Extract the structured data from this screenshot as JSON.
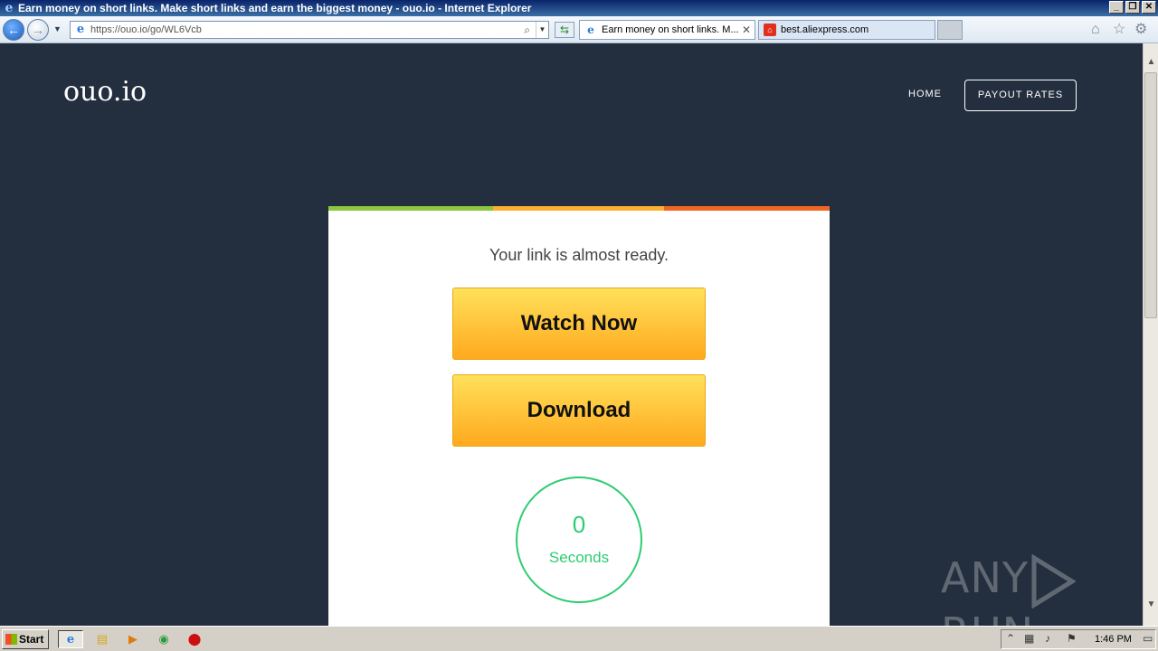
{
  "browser": {
    "window_title": "Earn money on short links. Make short links and earn the biggest money - ouo.io - Internet Explorer",
    "address_url": "https://ouo.io/go/WL6Vcb",
    "tabs": [
      {
        "label": "Earn money on short links. M...",
        "active": true
      },
      {
        "label": "best.aliexpress.com",
        "active": false
      }
    ]
  },
  "page": {
    "logo": "ouo.io",
    "nav": {
      "home": "HOME",
      "payout": "PAYOUT RATES"
    },
    "card": {
      "message": "Your link is almost ready.",
      "watch_button": "Watch Now",
      "download_button": "Download",
      "timer_value": "0",
      "timer_label": "Seconds",
      "stripe_colors": [
        "#8dc63f",
        "#fbb12f",
        "#f26522"
      ]
    },
    "background_color": "#232f3e",
    "watermark": "ANY RUN"
  },
  "taskbar": {
    "start_label": "Start",
    "clock": "1:46 PM"
  },
  "icons": {
    "ie": "internet-explorer-icon",
    "folder": "folder-icon",
    "media": "media-player-icon",
    "chrome": "chrome-icon",
    "opera": "opera-icon"
  }
}
